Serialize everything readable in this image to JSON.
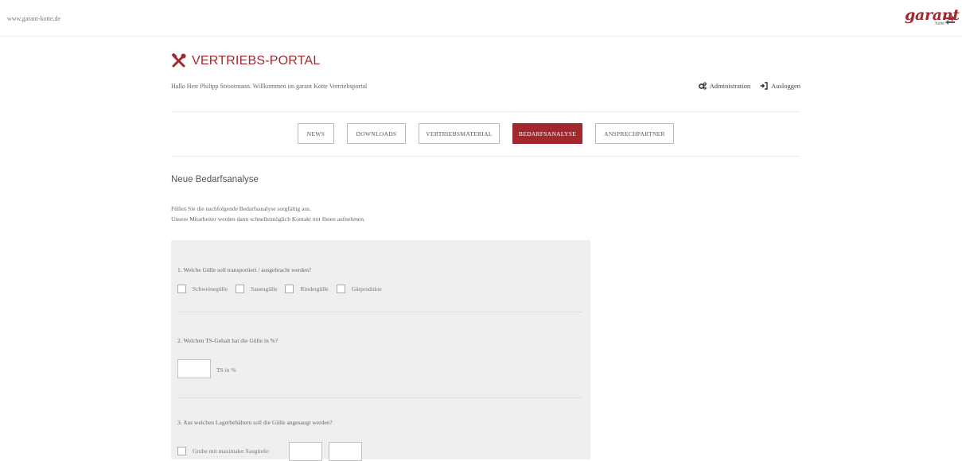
{
  "header": {
    "site_url": "www.garant-kotte.de",
    "logo_text": "garant",
    "logo_subtext": "Kotte"
  },
  "portal": {
    "title": "VERTRIEBS-PORTAL",
    "greeting": "Hallo Herr Philipp Strootmann. Willkommen im garant Kotte Vertriebsportal",
    "links": {
      "admin": "Administration",
      "logout": "Ausloggen"
    }
  },
  "nav": {
    "items": [
      {
        "label": "NEWS"
      },
      {
        "label": "DOWNLOADS"
      },
      {
        "label": "VERTRIEBSMATERIAL"
      },
      {
        "label": "BEDARFSANALYSE",
        "active": true
      },
      {
        "label": "ANSPRECHPARTNER"
      }
    ]
  },
  "main": {
    "title": "Neue Bedarfsanalyse",
    "intro_line1": "Füllen Sie die nachfolgende Bedarfsanalyse sorgfältig aus.",
    "intro_line2": "Unsere Mitarbeiter werden dann schnellstmöglich Kontakt mit Ihnen aufnehmen."
  },
  "form": {
    "q1": {
      "question": "1. Welche Gülle soll transportiert / ausgebracht werden?",
      "options": [
        "Schweinegülle",
        "Sauengülle",
        "Rindergülle",
        "Gärprodukte"
      ]
    },
    "q2": {
      "question": "2. Welchen TS-Gehalt hat die Gülle in %?",
      "unit": "TS in %",
      "value": ""
    },
    "q3": {
      "question": "3. Aus welchen Lagerbehältern soll die Gülle angesaugt werden?",
      "option1": "Grube mit maximaler Saugtiefe:"
    }
  },
  "colors": {
    "accent": "#a3282e",
    "form_bg": "#efefef"
  }
}
